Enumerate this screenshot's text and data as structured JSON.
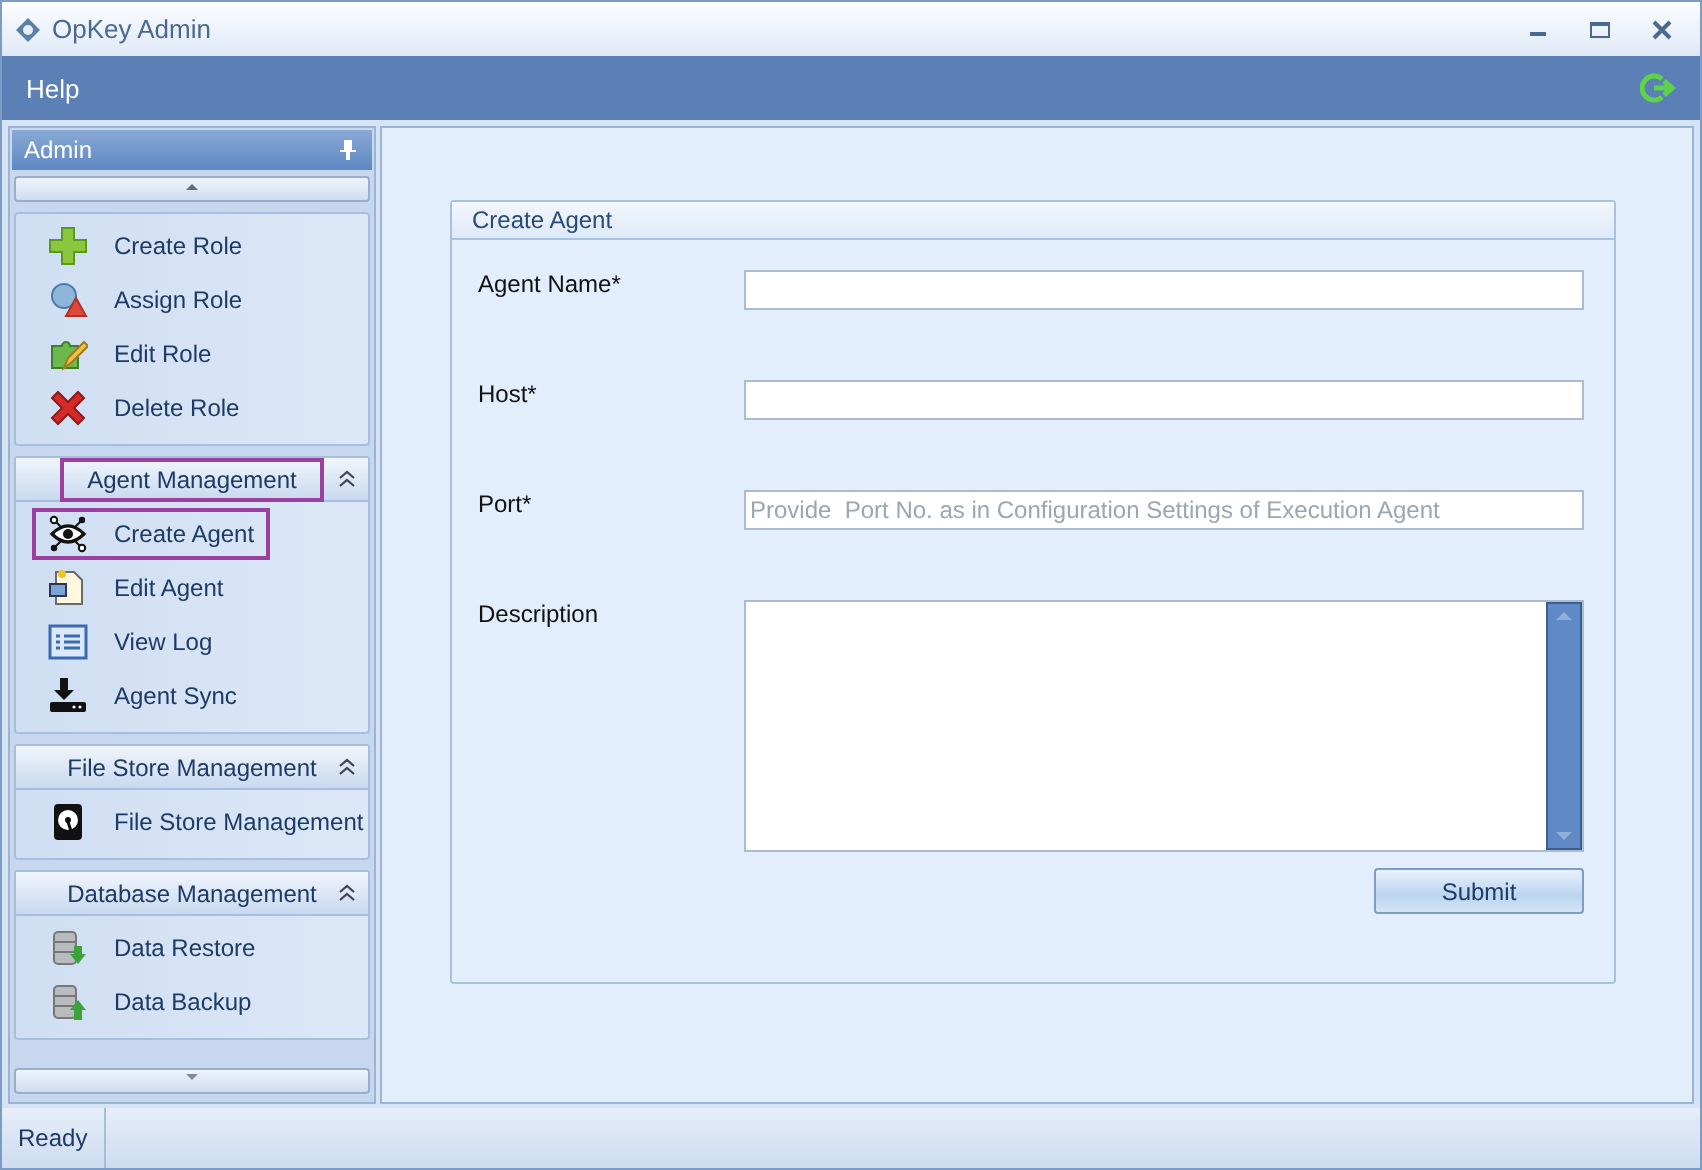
{
  "window": {
    "title": "OpKey Admin"
  },
  "menu": [
    {
      "label": "Help"
    }
  ],
  "sidebar": {
    "title": "Admin",
    "groups": [
      {
        "items": [
          {
            "label": "Create Role",
            "highlighted": false
          },
          {
            "label": "Assign Role",
            "highlighted": false
          },
          {
            "label": "Edit Role",
            "highlighted": false
          },
          {
            "label": "Delete Role",
            "highlighted": false
          }
        ]
      },
      {
        "header": "Agent Management",
        "highlighted": true,
        "expanded": true,
        "items": [
          {
            "label": "Create Agent",
            "highlighted": true
          },
          {
            "label": "Edit Agent",
            "highlighted": false
          },
          {
            "label": "View Log",
            "highlighted": false
          },
          {
            "label": "Agent Sync",
            "highlighted": false
          }
        ]
      },
      {
        "header": "File Store Management",
        "highlighted": false,
        "expanded": true,
        "items": [
          {
            "label": "File Store Management",
            "highlighted": false
          }
        ]
      },
      {
        "header": "Database Management",
        "highlighted": false,
        "expanded": true,
        "items": [
          {
            "label": "Data Restore",
            "highlighted": false
          },
          {
            "label": "Data Backup",
            "highlighted": false
          }
        ]
      }
    ]
  },
  "form": {
    "title": "Create Agent",
    "fields": [
      {
        "label": "Agent Name*",
        "kind": "text"
      },
      {
        "label": "Host*",
        "kind": "text"
      },
      {
        "label": "Port*",
        "kind": "text",
        "placeholder": "Provide  Port No. as in Configuration Settings of Execution Agent"
      },
      {
        "label": "Description",
        "kind": "textarea"
      }
    ],
    "submit": "Submit"
  },
  "status_bar": {
    "text": "Ready"
  }
}
